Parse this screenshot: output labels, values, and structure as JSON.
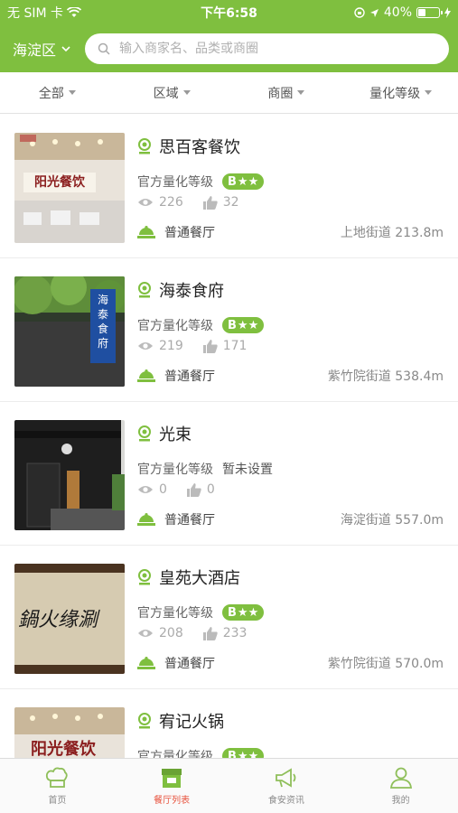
{
  "status": {
    "carrier": "无 SIM 卡",
    "time": "下午6:58",
    "battery": "40%",
    "battery_level": 0.4
  },
  "header": {
    "district": "海淀区",
    "search_placeholder": "输入商家名、品类或商圈"
  },
  "filters": [
    "全部",
    "区域",
    "商圈",
    "量化等级"
  ],
  "grade_label": "官方量化等级",
  "restaurants": [
    {
      "name": "思百客餐饮",
      "grade": "B",
      "views": "226",
      "likes": "32",
      "type": "普通餐厅",
      "distance": "上地街道 213.8m",
      "thumb_text": "阳光餐饮"
    },
    {
      "name": "海泰食府",
      "grade": "B",
      "views": "219",
      "likes": "171",
      "type": "普通餐厅",
      "distance": "紫竹院街道 538.4m",
      "thumb_text": "海泰食府"
    },
    {
      "name": "光束",
      "grade_text": "暂未设置",
      "views": "0",
      "likes": "0",
      "type": "普通餐厅",
      "distance": "海淀街道 557.0m"
    },
    {
      "name": "皇苑大酒店",
      "grade": "B",
      "views": "208",
      "likes": "233",
      "type": "普通餐厅",
      "distance": "紫竹院街道 570.0m",
      "thumb_text": "鍋火缘涮"
    },
    {
      "name": "宥记火锅",
      "grade": "B",
      "thumb_text": "阳光餐饮"
    }
  ],
  "tabs": [
    {
      "label": "首页",
      "icon": "chef-hat-icon"
    },
    {
      "label": "餐厅列表",
      "icon": "restaurant-store-icon"
    },
    {
      "label": "食安资讯",
      "icon": "megaphone-icon"
    },
    {
      "label": "我的",
      "icon": "user-icon"
    }
  ],
  "colors": {
    "brand": "#7fbf3f",
    "active_tab": "#e8533e"
  }
}
